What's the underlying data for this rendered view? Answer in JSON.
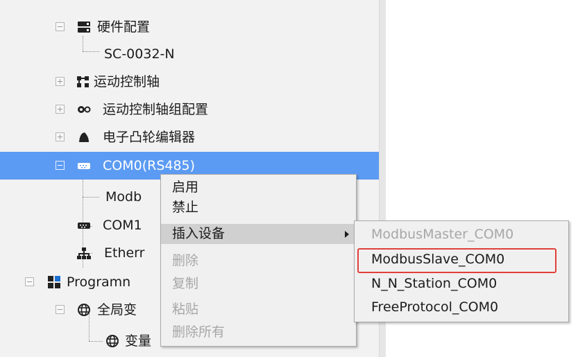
{
  "tree": {
    "rows": [
      {
        "label": "硬件配置",
        "icon": "hardware-config-icon"
      },
      {
        "label": "SC-0032-N"
      },
      {
        "label": "运动控制轴",
        "icon": "motion-axis-icon"
      },
      {
        "label": "运动控制轴组配置",
        "icon": "gears-icon"
      },
      {
        "label": "电子凸轮编辑器",
        "icon": "cam-icon"
      },
      {
        "label": "COM0(RS485)",
        "icon": "serial-port-icon"
      },
      {
        "label": "Modb"
      },
      {
        "label": "COM1",
        "icon": "serial-port-icon"
      },
      {
        "label": "Etherr",
        "icon": "network-icon"
      },
      {
        "label": "Programn",
        "icon": "program-blocks-icon"
      },
      {
        "label": "全局变",
        "icon": "globe-icon"
      },
      {
        "label": "变量",
        "icon": "globe-icon"
      }
    ]
  },
  "context_menu": {
    "items": [
      "启用",
      "禁止",
      "插入设备",
      "删除",
      "复制",
      "粘贴",
      "删除所有"
    ],
    "disabled": [
      false,
      false,
      false,
      true,
      true,
      true,
      true
    ]
  },
  "submenu": {
    "items": [
      "ModbusMaster_COM0",
      "ModbusSlave_COM0",
      "N_N_Station_COM0",
      "FreeProtocol_COM0"
    ],
    "disabled": [
      true,
      false,
      false,
      false
    ]
  },
  "colors": {
    "selection": "#5c9bf3",
    "highlight_box": "#e0403a"
  }
}
